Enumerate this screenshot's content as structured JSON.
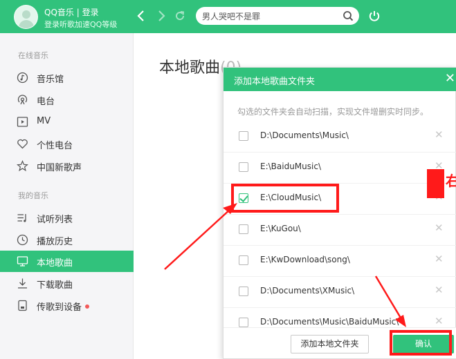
{
  "header": {
    "user_name": "QQ音乐 | 登录",
    "user_sub": "登录听歌加速QQ等级",
    "search_value": "男人哭吧不是罪"
  },
  "sidebar": {
    "online_title": "在线音乐",
    "online_items": [
      "音乐馆",
      "电台",
      "MV",
      "个性电台",
      "中国新歌声"
    ],
    "my_title": "我的音乐",
    "my_items": [
      "试听列表",
      "播放历史",
      "本地歌曲",
      "下载歌曲",
      "传歌到设备"
    ]
  },
  "main": {
    "title": "本地歌曲",
    "count": "(0)"
  },
  "dialog": {
    "title": "添加本地歌曲文件夹",
    "description": "勾选的文件夹会自动扫描，实现文件增删实时同步。",
    "folders": [
      {
        "path": "D:\\Documents\\Music\\",
        "checked": false
      },
      {
        "path": "E:\\BaiduMusic\\",
        "checked": false
      },
      {
        "path": "E:\\CloudMusic\\",
        "checked": true
      },
      {
        "path": "E:\\KuGou\\",
        "checked": false
      },
      {
        "path": "E:\\KwDownload\\song\\",
        "checked": false
      },
      {
        "path": "D:\\Documents\\XMusic\\",
        "checked": false
      },
      {
        "path": "D:\\Documents\\Music\\BaiduMusic\\",
        "checked": false
      }
    ],
    "add_button": "添加本地文件夹",
    "ok_button": "确认"
  },
  "annotation": {
    "glyph": "右",
    "color": "#ff1a1a"
  },
  "colors": {
    "brand": "#31c27c"
  }
}
